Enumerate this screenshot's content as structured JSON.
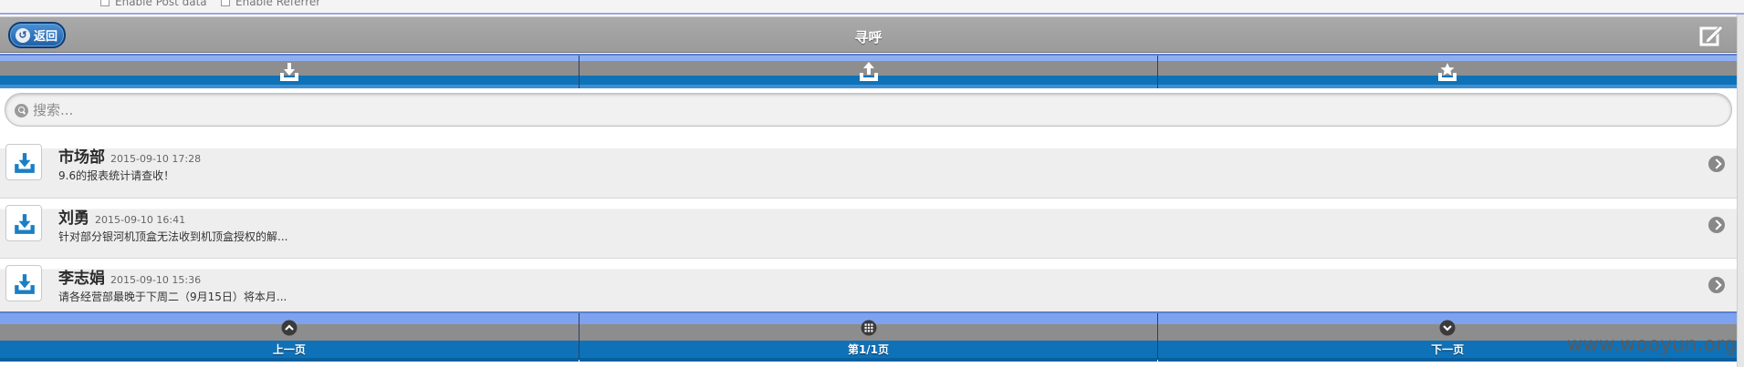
{
  "browser_options": {
    "option1": "Enable Post data",
    "option2": "Enable Referrer"
  },
  "header": {
    "back_label": "返回",
    "title": "寻呼",
    "edit_icon": "edit-icon"
  },
  "top_tabs": [
    {
      "icon": "inbox-download-icon"
    },
    {
      "icon": "outbox-upload-icon"
    },
    {
      "icon": "starred-tray-icon"
    }
  ],
  "search": {
    "placeholder": "搜索..."
  },
  "messages": [
    {
      "sender": "市场部",
      "time": "2015-09-10 17:28",
      "summary": "9.6的报表统计请查收！"
    },
    {
      "sender": "刘勇",
      "time": "2015-09-10 16:41",
      "summary": "针对部分银河机顶盒无法收到机顶盒授权的解..."
    },
    {
      "sender": "李志娟",
      "time": "2015-09-10 15:36",
      "summary": "请各经营部最晚于下周二（9月15日）将本月..."
    }
  ],
  "pager": {
    "prev": "上一页",
    "current": "第1/1页",
    "next": "下一页"
  },
  "watermark": "www.wooyun.org",
  "colors": {
    "header_gray": "#9b9b9b",
    "tab_blue": "#0f72b8",
    "back_button_blue": "#1f5fa6"
  }
}
